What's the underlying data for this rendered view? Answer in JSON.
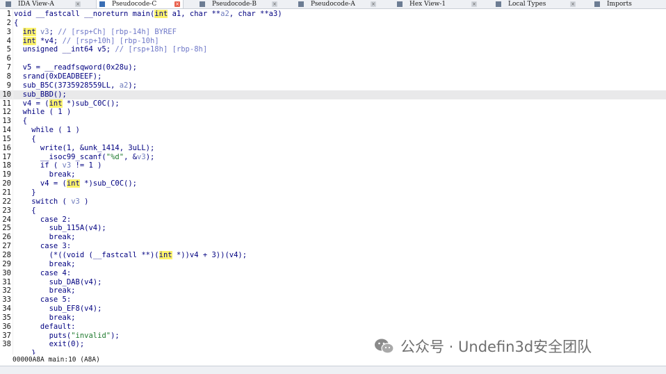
{
  "tabs": [
    {
      "label": "IDA View-A",
      "icon": "disassembly-icon",
      "active": false
    },
    {
      "label": "Pseudocode-C",
      "icon": "pseudocode-icon",
      "active": true
    },
    {
      "label": "Pseudocode-B",
      "icon": "pseudocode-icon",
      "active": false
    },
    {
      "label": "Pseudocode-A",
      "icon": "pseudocode-icon",
      "active": false
    },
    {
      "label": "Hex View-1",
      "icon": "hex-view-icon",
      "active": false
    },
    {
      "label": "Local Types",
      "icon": "local-types-icon",
      "active": false
    },
    {
      "label": "Imports",
      "icon": "imports-icon",
      "active": false
    }
  ],
  "code": {
    "current_line": 10,
    "lines": [
      {
        "n": "1",
        "t": "void __fastcall __noreturn main(int a1, char **a2, char **a3)"
      },
      {
        "n": "2",
        "t": "{"
      },
      {
        "n": "3",
        "t": "  int v3; // [rsp+Ch] [rbp-14h] BYREF"
      },
      {
        "n": "4",
        "t": "  int *v4; // [rsp+10h] [rbp-10h]"
      },
      {
        "n": "5",
        "t": "  unsigned __int64 v5; // [rsp+18h] [rbp-8h]"
      },
      {
        "n": "6",
        "t": ""
      },
      {
        "n": "7",
        "t": "  v5 = __readfsqword(0x28u);"
      },
      {
        "n": "8",
        "t": "  srand(0xDEADBEEF);"
      },
      {
        "n": "9",
        "t": "  sub_B5C(3735928559LL, a2);"
      },
      {
        "n": "10",
        "t": "  sub_BBD();"
      },
      {
        "n": "11",
        "t": "  v4 = (int *)sub_C0C();"
      },
      {
        "n": "12",
        "t": "  while ( 1 )"
      },
      {
        "n": "13",
        "t": "  {"
      },
      {
        "n": "14",
        "t": "    while ( 1 )"
      },
      {
        "n": "15",
        "t": "    {"
      },
      {
        "n": "16",
        "t": "      write(1, &unk_1414, 3uLL);"
      },
      {
        "n": "17",
        "t": "      __isoc99_scanf(\"%d\", &v3);"
      },
      {
        "n": "18",
        "t": "      if ( v3 != 1 )"
      },
      {
        "n": "19",
        "t": "        break;"
      },
      {
        "n": "20",
        "t": "      v4 = (int *)sub_C0C();"
      },
      {
        "n": "21",
        "t": "    }"
      },
      {
        "n": "22",
        "t": "    switch ( v3 )"
      },
      {
        "n": "23",
        "t": "    {"
      },
      {
        "n": "24",
        "t": "      case 2:"
      },
      {
        "n": "25",
        "t": "        sub_115A(v4);"
      },
      {
        "n": "26",
        "t": "        break;"
      },
      {
        "n": "27",
        "t": "      case 3:"
      },
      {
        "n": "28",
        "t": "        (*((void (__fastcall **)(int *))v4 + 3))(v4);"
      },
      {
        "n": "29",
        "t": "        break;"
      },
      {
        "n": "30",
        "t": "      case 4:"
      },
      {
        "n": "31",
        "t": "        sub_DAB(v4);"
      },
      {
        "n": "32",
        "t": "        break;"
      },
      {
        "n": "33",
        "t": "      case 5:"
      },
      {
        "n": "34",
        "t": "        sub_EF8(v4);"
      },
      {
        "n": "35",
        "t": "        break;"
      },
      {
        "n": "36",
        "t": "      default:"
      },
      {
        "n": "37",
        "t": "        puts(\"invalid\");"
      },
      {
        "n": "38",
        "t": "        exit(0);"
      },
      {
        "n": "",
        "t": "    }"
      }
    ]
  },
  "status": {
    "text": "00000A8A main:10 (A8A)"
  },
  "watermark": {
    "text": "公众号 · Undefin3d安全团队",
    "icon": "wechat-logo-icon"
  },
  "colors": {
    "highlight": "#fcf36b",
    "keyword": "#000080",
    "variable": "#6e7bbd",
    "current_line": "#e9e9ea"
  }
}
